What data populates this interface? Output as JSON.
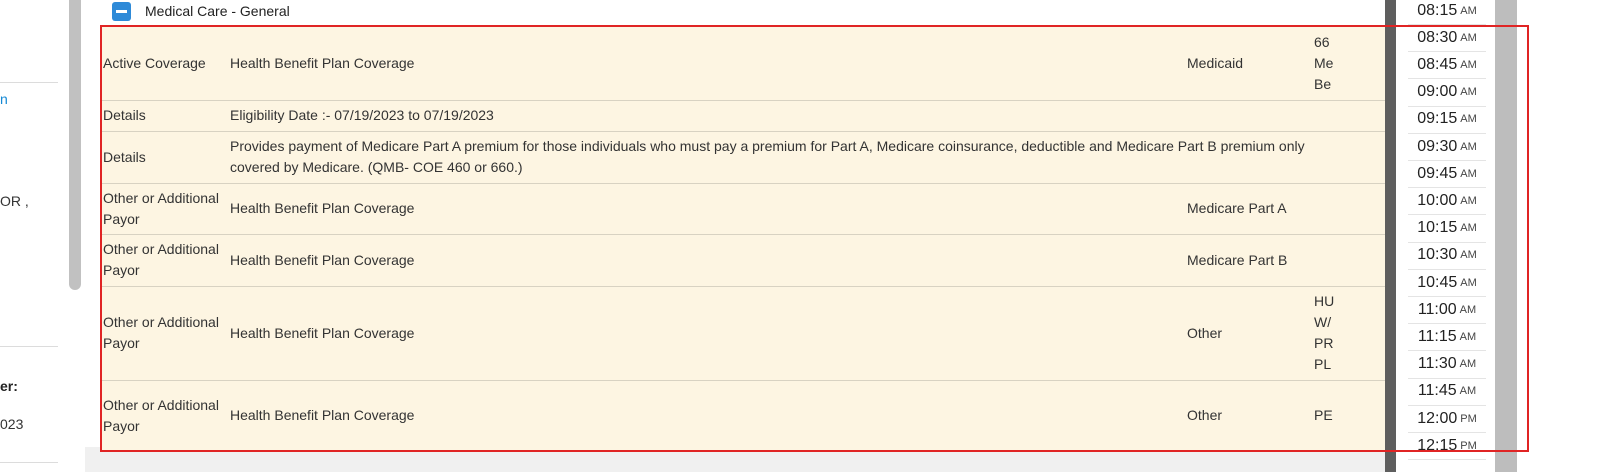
{
  "left_panel": {
    "link_fragment": "n",
    "address_fragment": "OR ,",
    "label_fragment": "er:",
    "year_fragment": "023"
  },
  "section": {
    "title": "Medical Care - General"
  },
  "rows": [
    {
      "type": "Active Coverage",
      "description": "Health Benefit Plan Coverage",
      "payor": "Medicaid",
      "info": "66 Me Be"
    },
    {
      "type": "Details",
      "description": "Eligibility Date :- 07/19/2023 to 07/19/2023",
      "payor": "",
      "info": ""
    },
    {
      "type": "Details",
      "description": "Provides payment of Medicare Part A premium for those individuals who must pay a premium for Part A, Medicare coinsurance, deductible and Medicare Part B premium only covered by Medicare. (QMB- COE 460 or 660.)",
      "payor": "",
      "info": ""
    },
    {
      "type": "Other or Additional Payor",
      "description": "Health Benefit Plan Coverage",
      "payor": "Medicare Part A",
      "info": ""
    },
    {
      "type": "Other or Additional Payor",
      "description": "Health Benefit Plan Coverage",
      "payor": "Medicare Part B",
      "info": ""
    },
    {
      "type": "Other or Additional Payor",
      "description": "Health Benefit Plan Coverage",
      "payor": "Other",
      "info": "HU W/ PR PL"
    },
    {
      "type": "Other or Additional Payor",
      "description": "Health Benefit Plan Coverage",
      "payor": "Other",
      "info": "PE"
    }
  ],
  "times": [
    {
      "time": "08:15",
      "ampm": "AM"
    },
    {
      "time": "08:30",
      "ampm": "AM"
    },
    {
      "time": "08:45",
      "ampm": "AM"
    },
    {
      "time": "09:00",
      "ampm": "AM"
    },
    {
      "time": "09:15",
      "ampm": "AM"
    },
    {
      "time": "09:30",
      "ampm": "AM"
    },
    {
      "time": "09:45",
      "ampm": "AM"
    },
    {
      "time": "10:00",
      "ampm": "AM"
    },
    {
      "time": "10:15",
      "ampm": "AM"
    },
    {
      "time": "10:30",
      "ampm": "AM"
    },
    {
      "time": "10:45",
      "ampm": "AM"
    },
    {
      "time": "11:00",
      "ampm": "AM"
    },
    {
      "time": "11:15",
      "ampm": "AM"
    },
    {
      "time": "11:30",
      "ampm": "AM"
    },
    {
      "time": "11:45",
      "ampm": "AM"
    },
    {
      "time": "12:00",
      "ampm": "PM"
    },
    {
      "time": "12:15",
      "ampm": "PM"
    }
  ],
  "icons": {
    "collapse": "minus-icon"
  },
  "colors": {
    "highlight_bg": "#fdf5e2",
    "outline": "#e02424",
    "accent": "#2e8ad8"
  }
}
